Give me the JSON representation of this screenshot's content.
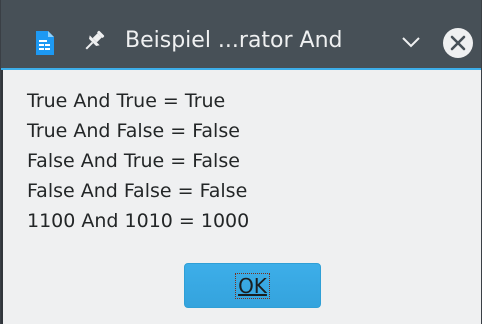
{
  "window": {
    "title": "Beispiel ...rator And",
    "icons": {
      "app": "document-icon",
      "pin": "pin-icon",
      "menu": "chevron-down-icon",
      "close": "close-icon"
    }
  },
  "dialog": {
    "lines": [
      "True And True = True",
      "True And False = False",
      "False And True = False",
      "False And False = False",
      "1100 And 1010 = 1000"
    ],
    "ok_label": "OK"
  },
  "colors": {
    "titlebar": "#475057",
    "accent": "#3daee9",
    "background": "#eff0f1"
  }
}
